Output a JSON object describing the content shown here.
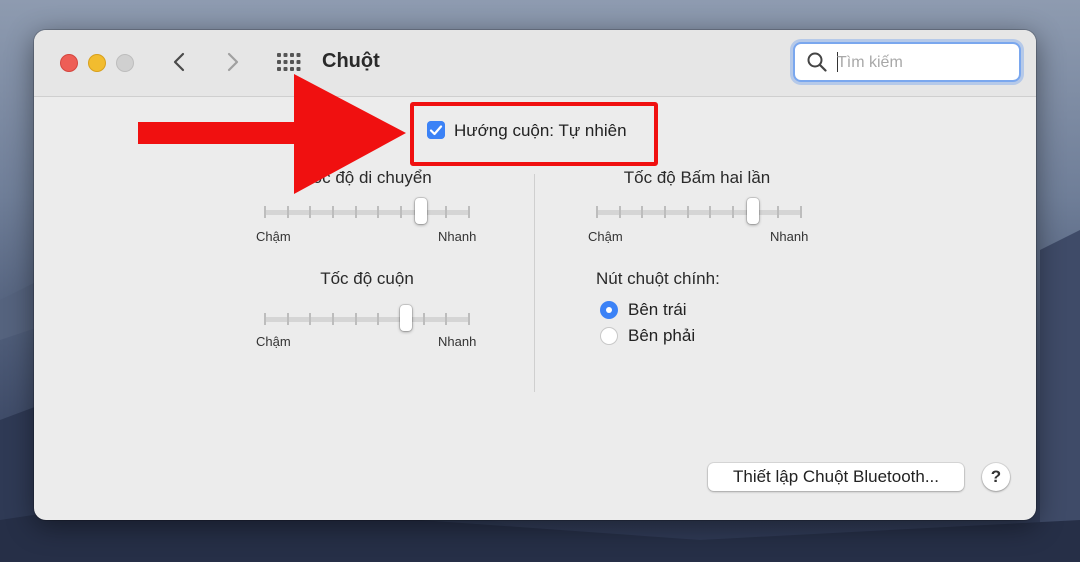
{
  "window": {
    "title": "Chuột"
  },
  "search": {
    "placeholder": "Tìm kiếm",
    "value": ""
  },
  "natural_scroll": {
    "label": "Hướng cuộn: Tự nhiên",
    "checked": true
  },
  "tracking_speed": {
    "label": "Tốc độ di chuyển",
    "min_label": "Chậm",
    "max_label": "Nhanh",
    "level": 0.78
  },
  "double_click_speed": {
    "label": "Tốc độ Bấm hai lần",
    "min_label": "Chậm",
    "max_label": "Nhanh",
    "level": 0.78
  },
  "scroll_speed": {
    "label": "Tốc độ cuộn",
    "min_label": "Chậm",
    "max_label": "Nhanh",
    "level": 0.7
  },
  "primary_button": {
    "label": "Nút chuột chính:",
    "options": [
      "Bên trái",
      "Bên phải"
    ],
    "selected": "Bên trái"
  },
  "footer": {
    "bluetooth_button": "Thiết lập Chuột Bluetooth...",
    "help_button": "?"
  },
  "colors": {
    "accent": "#3b82f6",
    "highlight": "#f01010"
  },
  "icons": [
    "close-icon",
    "minimize-icon",
    "zoom-icon",
    "chevron-left-icon",
    "chevron-right-icon",
    "grid-icon",
    "search-icon",
    "arrow-annotation-icon"
  ]
}
